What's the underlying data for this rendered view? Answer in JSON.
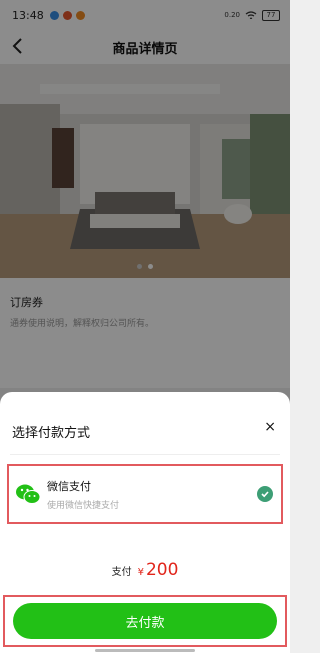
{
  "status_bar": {
    "time": "13:48",
    "network": "0.20",
    "battery": "77"
  },
  "header": {
    "title": "商品详情页"
  },
  "product": {
    "name": "订房券",
    "description": "通券使用说明，解释权归公司所有。",
    "carousel": {
      "total": 2,
      "active": 2
    }
  },
  "payment_sheet": {
    "title": "选择付款方式",
    "close_label": "×",
    "method": {
      "name": "微信支付",
      "subtitle": "使用微信快捷支付",
      "selected": true,
      "icon": "wechat-icon"
    },
    "pay_label": "支付",
    "currency": "¥",
    "amount": "200",
    "button_label": "去付款"
  },
  "colors": {
    "accent_green": "#22c016",
    "price_red": "#e1251b",
    "highlight_border": "#e25a5e",
    "check": "#3d9e75"
  }
}
